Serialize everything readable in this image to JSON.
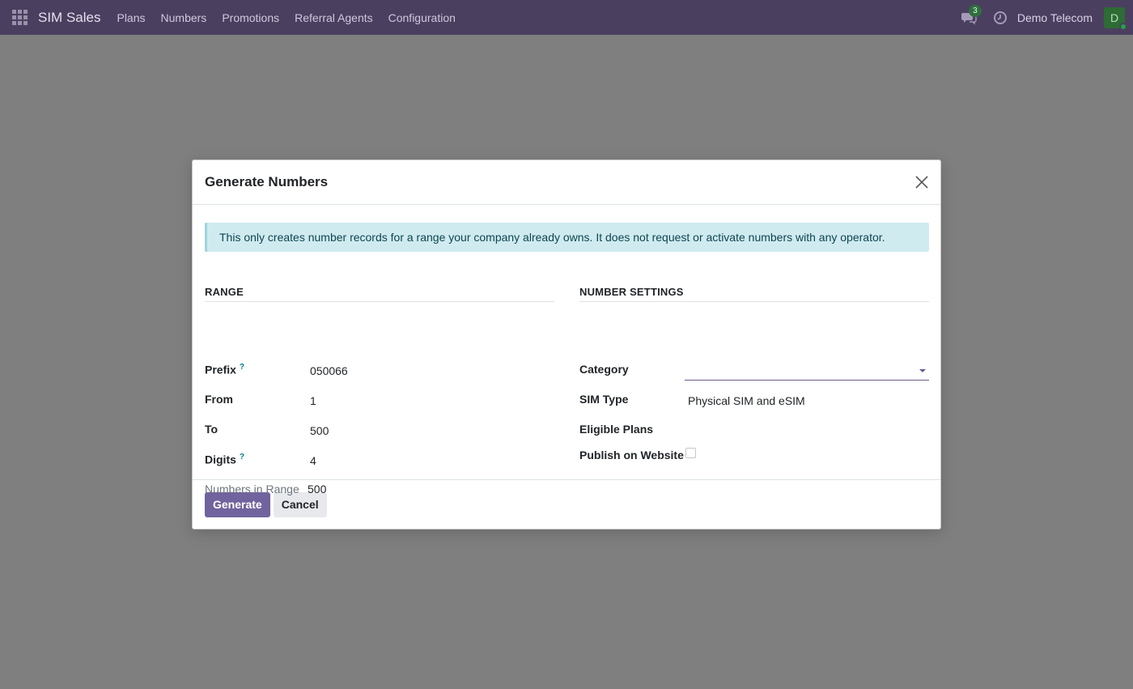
{
  "navbar": {
    "app_name": "SIM Sales",
    "menu": [
      "Plans",
      "Numbers",
      "Promotions",
      "Referral Agents",
      "Configuration"
    ],
    "chat_count": "3",
    "company": "Demo Telecom",
    "avatar_letter": "D",
    "icons": [
      "apps-grid-icon",
      "chat-icon",
      "clock-icon"
    ]
  },
  "dialog": {
    "title": "Generate Numbers",
    "alert": "This only creates number records for a range your company already owns. It does not request or activate numbers with any operator.",
    "range": {
      "heading": "RANGE",
      "prefix_label": "Prefix",
      "prefix_help": "?",
      "prefix_value": "050066",
      "from_label": "From",
      "from_value": "1",
      "to_label": "To",
      "to_value": "500",
      "digits_label": "Digits",
      "digits_help": "?",
      "digits_value": "4",
      "count_label": "Numbers in Range",
      "count_value": "500"
    },
    "settings": {
      "heading": "NUMBER SETTINGS",
      "category_label": "Category",
      "category_value": "",
      "sim_type_label": "SIM Type",
      "sim_type_value": "Physical SIM and eSIM",
      "eligible_plans_label": "Eligible Plans",
      "publish_label": "Publish on Website",
      "publish_checked": false
    },
    "buttons": {
      "generate": "Generate",
      "cancel": "Cancel"
    }
  },
  "colors": {
    "navbar_bg": "#4b3f60",
    "primary": "#71639e",
    "alert_bg": "#d0ebf0",
    "overlay": "#7f7f7f"
  }
}
